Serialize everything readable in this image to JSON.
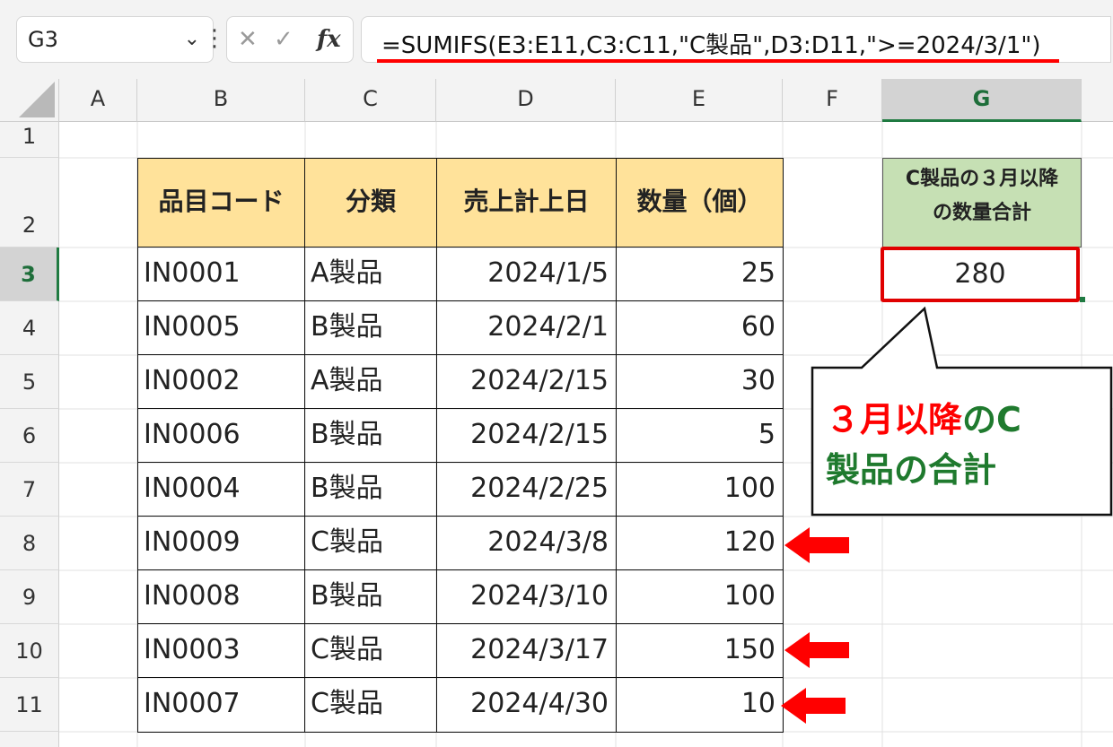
{
  "formula_bar": {
    "name_box": "G3",
    "name_box_arrow": "⌄",
    "dots": "⋮",
    "cancel_icon": "✕",
    "enter_icon": "✓",
    "fx_label": "fx",
    "formula": "=SUMIFS(E3:E11,C3:C11,\"C製品\",D3:D11,\">=2024/3/1\")"
  },
  "columns": [
    "A",
    "B",
    "C",
    "D",
    "E",
    "F",
    "G"
  ],
  "rows": [
    "1",
    "2",
    "3",
    "4",
    "5",
    "6",
    "7",
    "8",
    "9",
    "10",
    "11"
  ],
  "table": {
    "headers": [
      "品目コード",
      "分類",
      "売上計上日",
      "数量（個）"
    ],
    "rows": [
      [
        "IN0001",
        "A製品",
        "2024/1/5",
        "25"
      ],
      [
        "IN0005",
        "B製品",
        "2024/2/1",
        "60"
      ],
      [
        "IN0002",
        "A製品",
        "2024/2/15",
        "30"
      ],
      [
        "IN0006",
        "B製品",
        "2024/2/15",
        "5"
      ],
      [
        "IN0004",
        "B製品",
        "2024/2/25",
        "100"
      ],
      [
        "IN0009",
        "C製品",
        "2024/3/8",
        "120"
      ],
      [
        "IN0008",
        "B製品",
        "2024/3/10",
        "100"
      ],
      [
        "IN0003",
        "C製品",
        "2024/3/17",
        "150"
      ],
      [
        "IN0007",
        "C製品",
        "2024/4/30",
        "10"
      ]
    ]
  },
  "result": {
    "header_line1": "C製品の３月以降",
    "header_line2": "の数量合計",
    "value": "280"
  },
  "callout": {
    "part1_red": "３月以降",
    "part2_green": "のC",
    "line2_green": "製品の合計"
  },
  "colors": {
    "accent_red": "#ff0000",
    "header_yellow": "#ffe29a",
    "header_green": "#c6e0b4",
    "callout_green": "#1f7a2e"
  }
}
